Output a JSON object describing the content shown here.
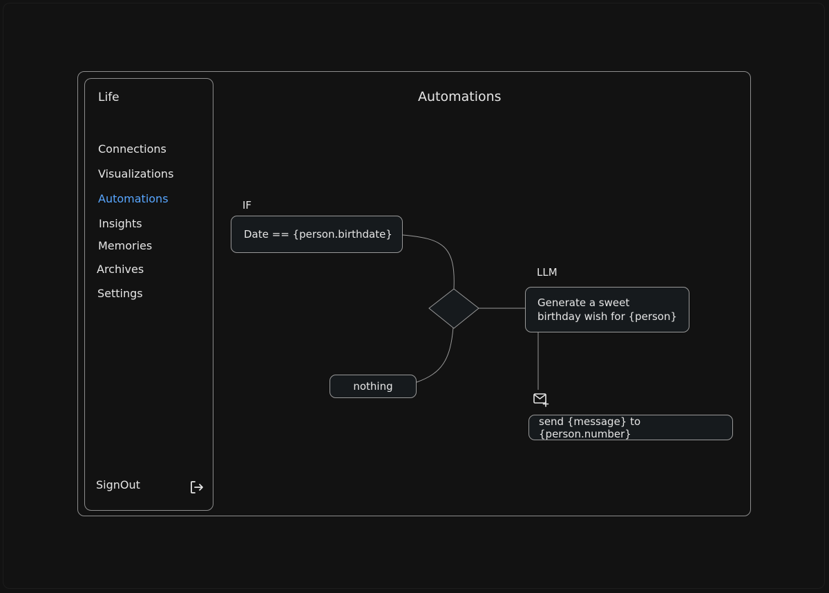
{
  "sidebar": {
    "brand": "Life",
    "items": [
      {
        "label": "Connections"
      },
      {
        "label": "Visualizations"
      },
      {
        "label": "Automations"
      },
      {
        "label": "Insights"
      },
      {
        "label": "Memories"
      },
      {
        "label": "Archives"
      },
      {
        "label": "Settings"
      }
    ],
    "active_item": "Automations",
    "signout_label": "SignOut",
    "signout_icon": "sign-out-icon"
  },
  "main": {
    "title": "Automations"
  },
  "flow": {
    "if_label": "IF",
    "condition": "Date == {person.birthdate}",
    "else_node": "nothing",
    "llm_label": "LLM",
    "llm_prompt_line1": "Generate a sweet",
    "llm_prompt_line2": "birthday wish for {person}",
    "action_icon": "mail-plus-icon",
    "action": "send {message} to {person.number}"
  },
  "colors": {
    "background": "#121212",
    "border": "#8e8e8e",
    "active": "#58a6ff",
    "node_fill": "#161a1d"
  }
}
